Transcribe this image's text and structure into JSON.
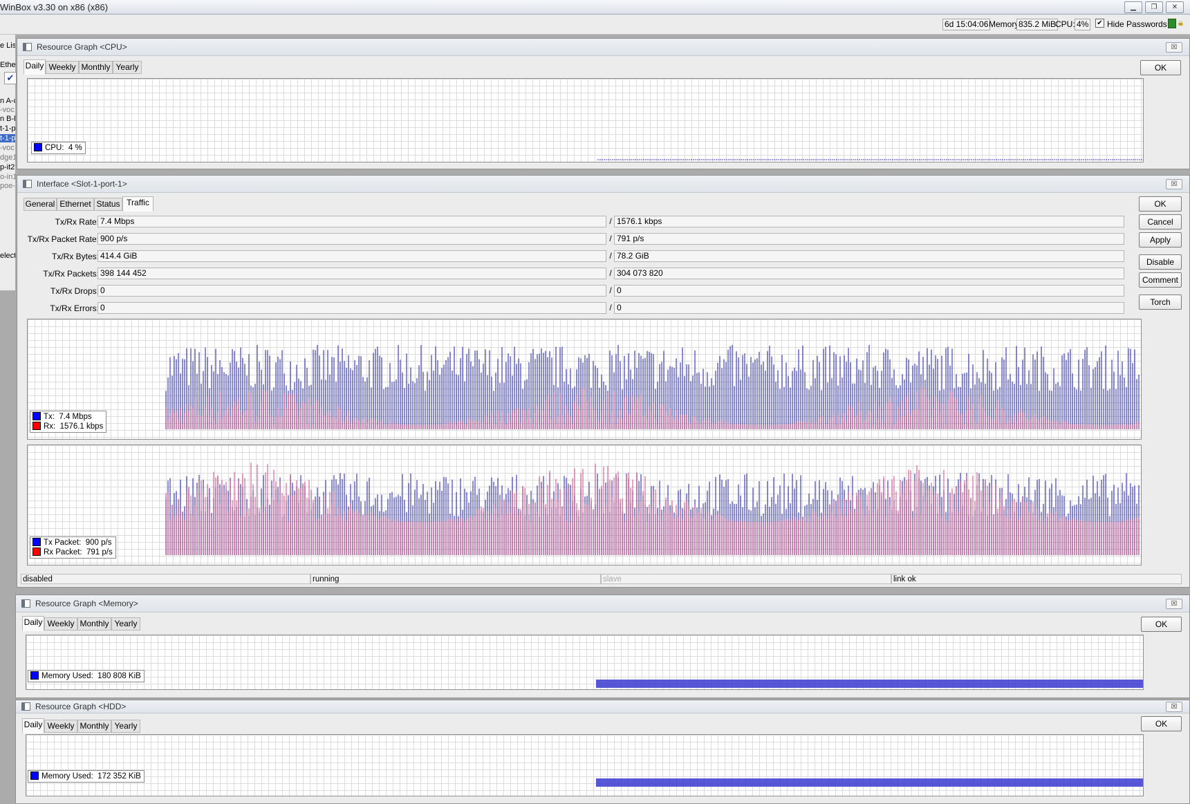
{
  "app": {
    "title": "WinBox v3.30 on x86 (x86)",
    "window_controls": [
      "minimize-icon",
      "restore-icon",
      "close-icon"
    ]
  },
  "toolbar": {
    "uptime": "6d 15:04:06",
    "memory_label": "Memory:",
    "memory_value": "835.2 MiB",
    "cpu_label": "CPU:",
    "cpu_value": "4%",
    "hide_passwords_label": "Hide Passwords",
    "hide_passwords_checked": true,
    "checkmark": "✔",
    "status_icons": [
      "green-status-icon",
      "lock-icon"
    ]
  },
  "left_panel": {
    "items": [
      "e Lis",
      "Ethe",
      "n A-c",
      "-voc",
      "n B-l",
      "t-1-p",
      "t-1-p",
      "-voc",
      "dge1",
      "p-it2",
      "o-in1",
      "poe-i",
      "elect"
    ]
  },
  "tab_labels": [
    "Daily",
    "Weekly",
    "Monthly",
    "Yearly"
  ],
  "cpu_window": {
    "title": "Resource Graph <CPU>",
    "close": "☒",
    "active_tab": "Daily",
    "ok_label": "OK",
    "legend": {
      "label": "CPU:",
      "value": "4 %",
      "color": "#0000ff"
    }
  },
  "interface_window": {
    "title": "Interface <Slot-1-port-1>",
    "close": "☒",
    "tabs": [
      "General",
      "Ethernet",
      "Status",
      "Traffic"
    ],
    "active_tab": "Traffic",
    "buttons": [
      "OK",
      "Cancel",
      "Apply",
      "Disable",
      "Comment",
      "Torch"
    ],
    "separator": "/",
    "fields": [
      {
        "label": "Tx/Rx Rate:",
        "tx": "7.4 Mbps",
        "rx": "1576.1 kbps"
      },
      {
        "label": "Tx/Rx Packet Rate:",
        "tx": "900 p/s",
        "rx": "791 p/s"
      },
      {
        "label": "Tx/Rx Bytes:",
        "tx": "414.4 GiB",
        "rx": "78.2 GiB"
      },
      {
        "label": "Tx/Rx Packets:",
        "tx": "398 144 452",
        "rx": "304 073 820"
      },
      {
        "label": "Tx/Rx Drops:",
        "tx": "0",
        "rx": "0"
      },
      {
        "label": "Tx/Rx Errors:",
        "tx": "0",
        "rx": "0"
      }
    ],
    "traffic_legend": [
      {
        "label": "Tx:",
        "value": "7.4 Mbps",
        "color": "#0000ff"
      },
      {
        "label": "Rx:",
        "value": "1576.1 kbps",
        "color": "#ff0000"
      }
    ],
    "packet_legend": [
      {
        "label": "Tx Packet:",
        "value": "900 p/s",
        "color": "#0000ff"
      },
      {
        "label": "Rx Packet:",
        "value": "791 p/s",
        "color": "#ff0000"
      }
    ],
    "status_bar": [
      "disabled",
      "running",
      "slave",
      "link ok"
    ]
  },
  "memory_window": {
    "title": "Resource Graph <Memory>",
    "close": "☒",
    "active_tab": "Daily",
    "ok_label": "OK",
    "legend": {
      "label": "Memory Used:",
      "value": "180 808 KiB",
      "color": "#0000ff"
    }
  },
  "hdd_window": {
    "title": "Resource Graph <HDD>",
    "close": "☒",
    "active_tab": "Daily",
    "ok_label": "OK",
    "legend": {
      "label": "Memory Used:",
      "value": "172 352 KiB",
      "color": "#0000ff"
    }
  },
  "colors": {
    "tx": "#1a1aa8",
    "rx": "#c01060",
    "graph_line": "#3333cc"
  }
}
